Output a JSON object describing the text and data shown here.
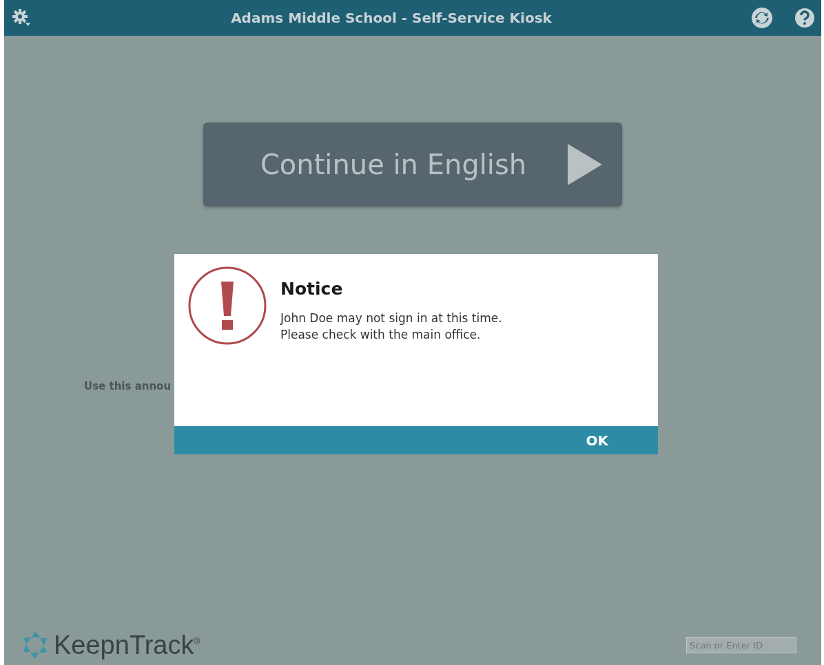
{
  "header": {
    "title": "Adams Middle School - Self-Service Kiosk"
  },
  "language_button": {
    "label": "Continue in English"
  },
  "announcement": "Use this annou",
  "dialog": {
    "title": "Notice",
    "lines": [
      "John Doe may not sign in at this time.",
      "Please check with the main office."
    ],
    "button": "OK"
  },
  "logo": {
    "text": "KeepnTrack$^{®}$"
  },
  "id_field": {
    "placeholder": "Scan or Enter ID"
  }
}
